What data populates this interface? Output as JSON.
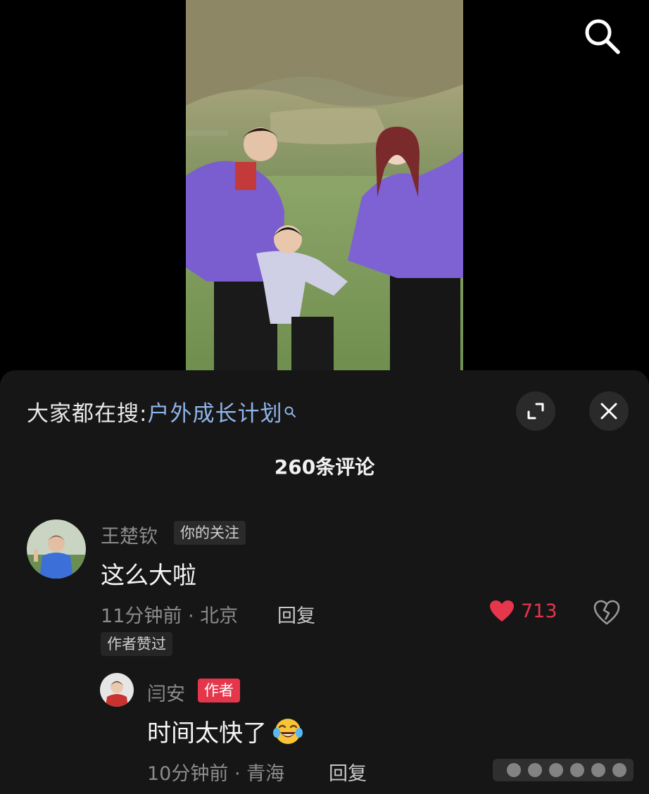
{
  "header": {
    "search_icon": "search-icon"
  },
  "trending": {
    "prefix": "大家都在搜:",
    "term": "户外成长计划",
    "icon": "search-small-icon"
  },
  "sheet": {
    "comment_count": "260条评论",
    "expand_icon": "expand-icon",
    "close_icon": "close-icon"
  },
  "comments": [
    {
      "username": "王楚钦",
      "badge": "你的关注",
      "text": "这么大啦",
      "time_location": "11分钟前 · 北京",
      "reply_label": "回复",
      "likes": "713",
      "liked": true,
      "author_liked_label": "作者赞过",
      "replies": [
        {
          "username": "闫安",
          "badge": "作者",
          "text": "时间太快了",
          "emoji": "laughing-tears-emoji",
          "time_location": "10分钟前 · 青海",
          "reply_label": "回复"
        }
      ]
    }
  ],
  "colors": {
    "sheet_bg": "#161616",
    "trend_term": "#8fb4ea",
    "like_red": "#e5364c",
    "author_badge": "#e5364c",
    "muted_text": "#8c8c8c"
  }
}
